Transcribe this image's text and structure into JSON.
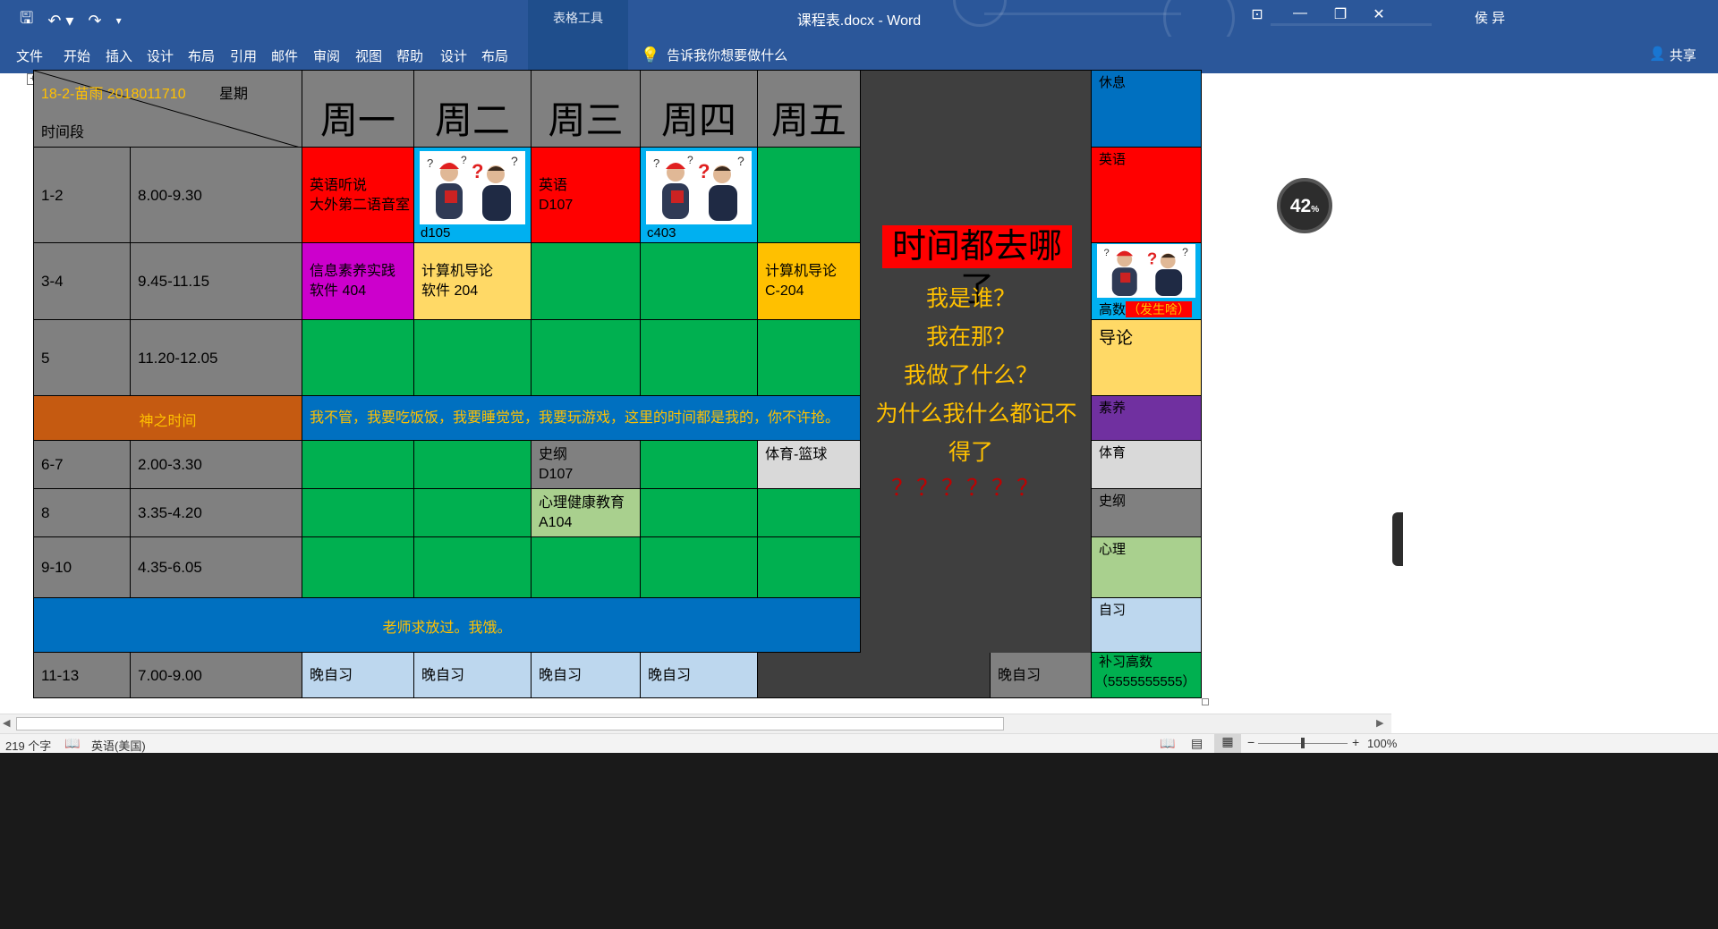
{
  "titlebar": {
    "quick_access": [
      "save-icon",
      "undo-icon",
      "redo-icon",
      "customize-icon"
    ],
    "context_label": "表格工具",
    "doc_title": "课程表.docx  -  Word",
    "user": "侯 异",
    "ribbon_options_icon": "ribbon-display-icon",
    "win_controls": [
      "minimize-icon",
      "restore-icon",
      "close-icon"
    ]
  },
  "ribbon": {
    "tabs": [
      "文件",
      "开始",
      "插入",
      "设计",
      "布局",
      "引用",
      "邮件",
      "审阅",
      "视图",
      "帮助"
    ],
    "context_tabs": [
      "设计",
      "布局"
    ],
    "tellme": "告诉我你想要做什么",
    "share": "共享"
  },
  "table": {
    "header": {
      "name": "18-2-苗雨  2018011710",
      "week_label": "星期",
      "time_label": "时间段",
      "days": [
        "周一",
        "周二",
        "周三",
        "周四",
        "周五"
      ]
    },
    "rows": {
      "r1": {
        "period": "1-2",
        "time": "8.00-9.30",
        "mon": [
          "英语听说",
          "大外第二语音室"
        ],
        "tue": "d105",
        "wed": [
          "英语",
          "D107"
        ],
        "thu": "c403"
      },
      "r2": {
        "period": "3-4",
        "time": "9.45-11.15",
        "mon": [
          "信息素养实践",
          "软件 404"
        ],
        "tue": [
          "计算机导论",
          "软件 204"
        ],
        "fri": [
          "计算机导论",
          "C-204"
        ]
      },
      "r3": {
        "period": "5",
        "time": "11.20-12.05"
      },
      "divine": {
        "label": "神之时间",
        "text": "我不管，我要吃饭饭，我要睡觉觉，我要玩游戏，这里的时间都是我的，你不许抢。"
      },
      "r4": {
        "period": "6-7",
        "time": "2.00-3.30",
        "wed": [
          "史纲",
          "D107"
        ],
        "fri": "体育-篮球"
      },
      "r5": {
        "period": "8",
        "time": "3.35-4.20",
        "wed": [
          "心理健康教育",
          "A104"
        ]
      },
      "r6": {
        "period": "9-10",
        "time": "4.35-6.05"
      },
      "teacher": "老师求放过。我饿。",
      "r7": {
        "period": "11-13",
        "time": "7.00-9.00",
        "evening": "晚自习",
        "extra": "晚自习"
      }
    },
    "side_text": {
      "headline": "时间都去哪了",
      "lines": [
        "我是谁？",
        "我在那？",
        "我做了什么？",
        "为什么我什么都记不",
        "得了"
      ],
      "question_marks": "？？？？？？"
    },
    "legend": [
      {
        "label": "休息",
        "color": "#0070c0"
      },
      {
        "label": "英语",
        "color": "#ff0000"
      },
      {
        "label": "高数",
        "note": "（发生啥）",
        "color": "#00b0f0"
      },
      {
        "label": "导论",
        "color": "#ffd966"
      },
      {
        "label": "素养",
        "color": "#7030a0"
      },
      {
        "label": "体育",
        "color": "#d9d9d9"
      },
      {
        "label": "史纲",
        "color": "#808080"
      },
      {
        "label": "心理",
        "color": "#a9d08e"
      },
      {
        "label": "自习",
        "color": "#bdd7ee"
      },
      {
        "label": "补习高数",
        "note": "（5555555555）",
        "color": "#00b050"
      }
    ]
  },
  "badge": {
    "value": "42",
    "unit": "%"
  },
  "status": {
    "words": "219 个字",
    "language": "英语(美国)",
    "zoom": "100%"
  }
}
